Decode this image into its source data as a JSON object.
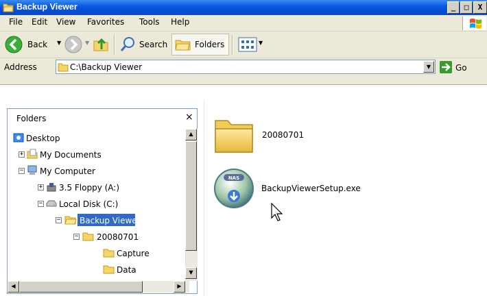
{
  "window": {
    "title": "Backup Viewer",
    "controls": {
      "minimize": "_",
      "maximize": "□",
      "close": "X"
    }
  },
  "menu": {
    "items": [
      "File",
      "Edit",
      "View",
      "Favorites",
      "Tools",
      "Help"
    ]
  },
  "toolbar": {
    "back_label": "Back",
    "search_label": "Search",
    "folders_label": "Folders"
  },
  "address": {
    "label": "Address",
    "path": "C:\\Backup Viewer",
    "go_label": "Go"
  },
  "folders_pane": {
    "title": "Folders",
    "close": "×",
    "tree": [
      {
        "label": "Desktop",
        "icon": "desktop-icon"
      },
      {
        "label": "My Documents",
        "icon": "my-documents-icon",
        "expander": "+"
      },
      {
        "label": "My Computer",
        "icon": "my-computer-icon",
        "expander": "−"
      },
      {
        "label": "3.5 Floppy (A:)",
        "icon": "floppy-icon",
        "expander": "+"
      },
      {
        "label": "Local Disk (C:)",
        "icon": "disk-icon",
        "expander": "−"
      },
      {
        "label": "Backup Viewer",
        "icon": "folder-open-icon",
        "expander": "−",
        "selected": true
      },
      {
        "label": "20080701",
        "icon": "folder-icon",
        "expander": "−"
      },
      {
        "label": "Capture",
        "icon": "folder-icon"
      },
      {
        "label": "Data",
        "icon": "folder-icon"
      }
    ]
  },
  "content": {
    "items": [
      {
        "label": "20080701",
        "icon": "folder-large-icon"
      },
      {
        "label": "BackupViewerSetup.exe",
        "icon": "installer-icon",
        "icon_text": "NAS"
      }
    ]
  },
  "colors": {
    "titlebar": "#0a5ae0",
    "selection": "#316ac5",
    "chrome": "#ece9d8"
  }
}
